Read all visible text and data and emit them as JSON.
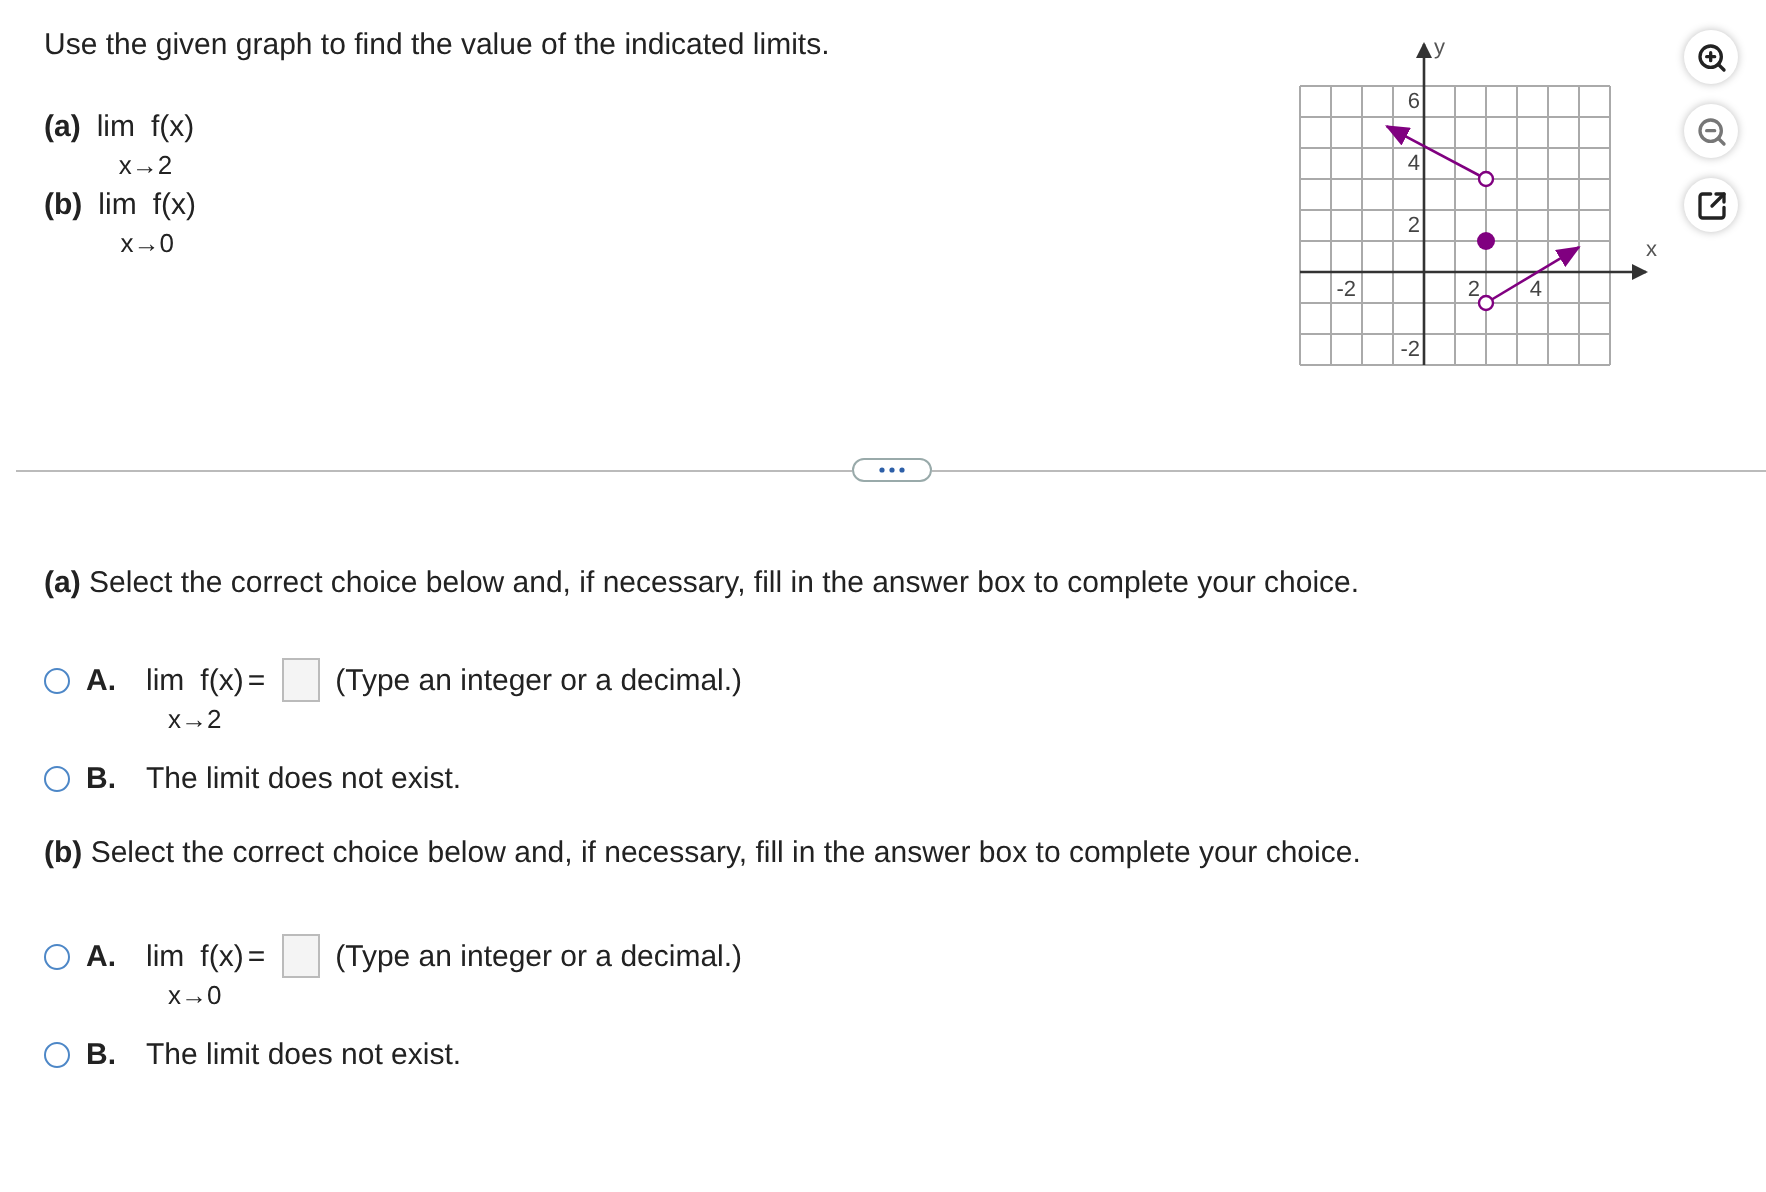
{
  "instructions": "Use the given graph to find the value of the indicated limits.",
  "limits": [
    {
      "label": "(a)",
      "lim": "lim",
      "function": "f(x)",
      "approach": "x→2"
    },
    {
      "label": "(b)",
      "lim": "lim",
      "function": "f(x)",
      "approach": "x→0"
    }
  ],
  "graph": {
    "x_label": "x",
    "y_label": "y",
    "x_tick_labels": [
      "-2",
      "2",
      "4"
    ],
    "y_tick_labels": [
      "6",
      "4",
      "2",
      "-2"
    ]
  },
  "tools": [
    {
      "kind": "zoom-in"
    },
    {
      "kind": "zoom-out"
    },
    {
      "kind": "popout"
    }
  ],
  "parts": [
    {
      "prompt": "**(a)** Select the correct choice below and, if necessary, fill in the answer box to complete your choice.",
      "choices": [
        {
          "kind": "answer",
          "letter": "A.",
          "selected": false,
          "lim": "lim",
          "function": "f(x)",
          "approach": "x→2",
          "equals": "=",
          "hint": "(Type an integer or a decimal.)"
        },
        {
          "kind": "statement",
          "letter": "B.",
          "selected": false,
          "text": "The limit does not exist."
        }
      ]
    },
    {
      "prompt": "**(b)** Select the correct choice below and, if necessary, fill in the answer box to complete your choice.",
      "choices": [
        {
          "kind": "answer",
          "letter": "A.",
          "selected": false,
          "lim": "lim",
          "function": "f(x)",
          "approach": "x→0",
          "equals": "=",
          "hint": "(Type an integer or a decimal.)"
        },
        {
          "kind": "statement",
          "letter": "B.",
          "selected": false,
          "text": "The limit does not exist."
        }
      ]
    }
  ]
}
